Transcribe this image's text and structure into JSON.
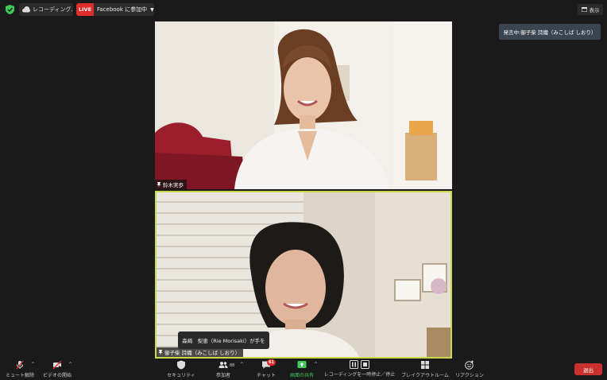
{
  "topbar": {
    "recording_label": "レコーディング...",
    "live_badge": "LIVE",
    "live_label": "Facebook に参加中",
    "view_label": "表示"
  },
  "speaking_indicator": "発言中:御子柴 詩織（みこしば しおり）",
  "participants": [
    {
      "name": "鈴木実歩"
    },
    {
      "name": "御子柴 詩織（みこしば しおり）"
    }
  ],
  "notification": "森崎　梨恵（Rie Morisaki）が手を",
  "toolbar": {
    "mute_label": "ミュート解除",
    "video_label": "ビデオの開始",
    "security_label": "セキュリティ",
    "participants_label": "参加者",
    "participants_count": "88",
    "chat_label": "チャット",
    "chat_badge": "61",
    "share_label": "画面の共有",
    "recording_label": "レコーディングを一時停止／停止",
    "breakout_label": "ブレイクアウトルーム",
    "reactions_label": "リアクション",
    "leave_label": "退出"
  },
  "colors": {
    "background": "#1a1a1a",
    "live_red": "#e02b2b",
    "active_speaker_border": "#c9d94a",
    "share_green": "#3ecb5a",
    "leave_red": "#c8312d"
  }
}
